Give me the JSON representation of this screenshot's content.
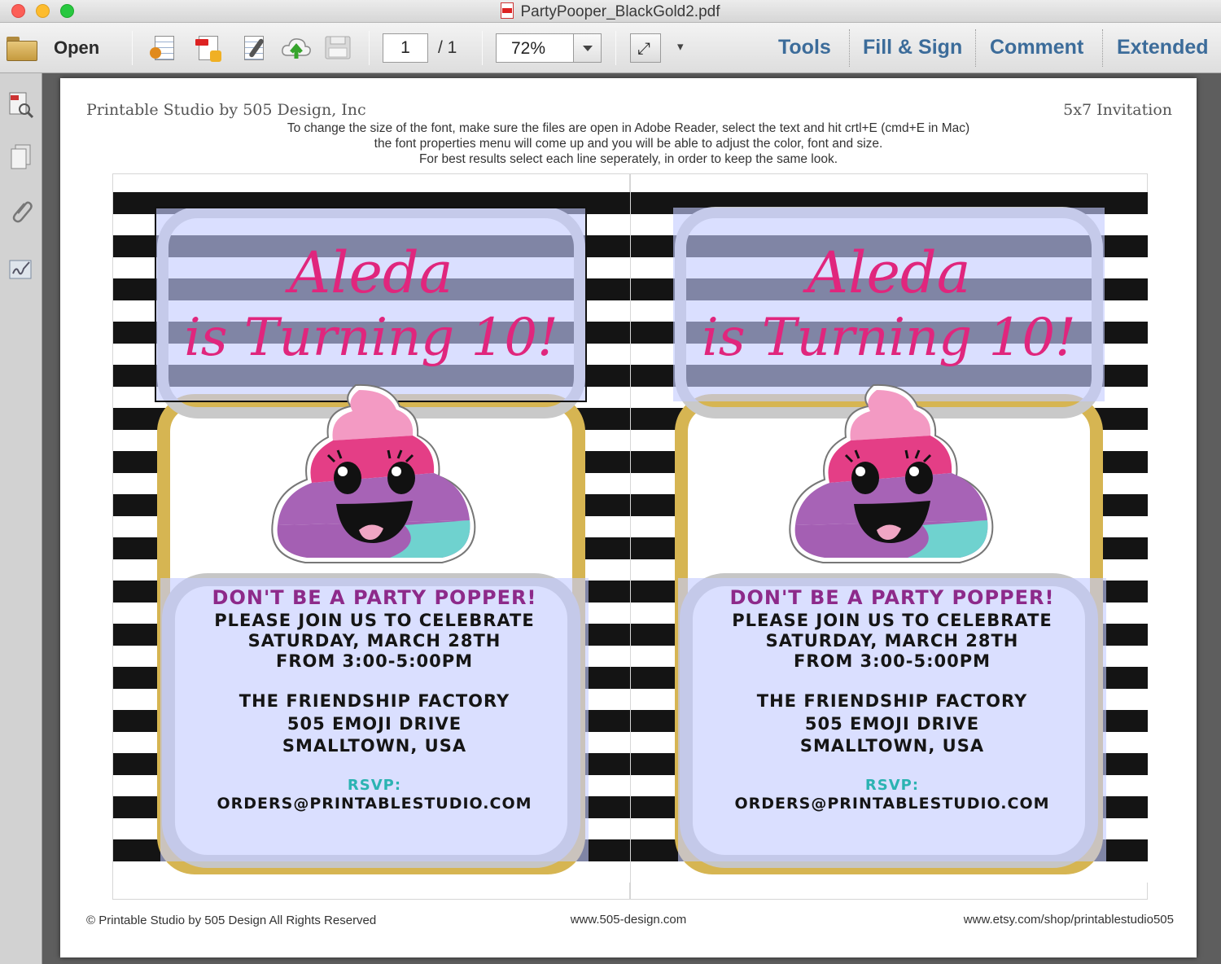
{
  "window": {
    "title": "PartyPooper_BlackGold2.pdf"
  },
  "toolbar": {
    "open_label": "Open",
    "page_current": "1",
    "page_total": "/ 1",
    "zoom": "72%",
    "tools_label": "Tools",
    "fill_sign_label": "Fill & Sign",
    "comment_label": "Comment",
    "extended_label": "Extended"
  },
  "page": {
    "header_left": "Printable Studio by 505 Design, Inc",
    "header_right": "5x7 Invitation",
    "instructions": [
      "To change the size of the font, make sure the files are open in Adobe Reader, select the text and hit crtl+E (cmd+E in Mac)",
      "the font properties menu will come up and you will be able to adjust the color, font and size.",
      "For best results select each line seperately, in order to keep the same look."
    ],
    "footer_left": "© Printable Studio by 505 Design All Rights Reserved",
    "footer_center": "www.505-design.com",
    "footer_right": "www.etsy.com/shop/printablestudio505"
  },
  "invitation": {
    "name": "Aleda",
    "turning": "is Turning 10!",
    "headline": "DON'T BE A PARTY POPPER!",
    "line1": "PLEASE JOIN US TO CELEBRATE",
    "line2": "SATURDAY, MARCH 28TH",
    "line3": "FROM 3:00-5:00PM",
    "venue1": "THE FRIENDSHIP FACTORY",
    "venue2": "505 EMOJI DRIVE",
    "venue3": "SMALLTOWN, USA",
    "rsvp_label": "RSVP:",
    "rsvp_email": "ORDERS@PRINTABLESTUDIO.COM"
  },
  "colors": {
    "script_pink": "#e0267d",
    "headline_purple": "#8d2a8a",
    "rsvp_teal": "#2bb3b2",
    "toolbar_tab_blue": "#3c6c9a"
  },
  "icons": [
    "folder-icon",
    "save-as-pdf-icon",
    "export-pdf-icon",
    "edit-pdf-icon",
    "upload-cloud-icon",
    "save-icon",
    "fullscreen-icon",
    "pages-search-icon",
    "page-thumbnails-icon",
    "attachments-icon",
    "signature-icon",
    "pdf-file-icon"
  ]
}
